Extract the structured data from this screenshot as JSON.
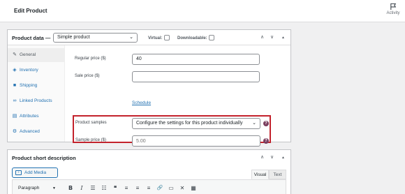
{
  "header": {
    "title": "Edit Product",
    "activity_label": "Activity",
    "activity_icon": "flag-icon"
  },
  "product_data": {
    "title": "Product data —",
    "type_select": {
      "value": "Simple product"
    },
    "virtual_label": "Virtual:",
    "virtual_checked": false,
    "downloadable_label": "Downloadable:",
    "downloadable_checked": false,
    "tabs": [
      {
        "label": "General",
        "icon": "wrench-icon",
        "active": true
      },
      {
        "label": "Inventory",
        "icon": "tag-icon",
        "active": false
      },
      {
        "label": "Shipping",
        "icon": "truck-icon",
        "active": false
      },
      {
        "label": "Linked Products",
        "icon": "link-icon",
        "active": false
      },
      {
        "label": "Attributes",
        "icon": "table-icon",
        "active": false
      },
      {
        "label": "Advanced",
        "icon": "gear-icon",
        "active": false
      }
    ],
    "regular_price": {
      "label": "Regular price ($)",
      "value": "40"
    },
    "sale_price": {
      "label": "Sale price ($)",
      "value": ""
    },
    "schedule_link": "Schedule",
    "product_samples": {
      "label": "Product samples",
      "value": "Configure the settings for this product individually"
    },
    "sample_price": {
      "label": "Sample price ($)",
      "placeholder": "5.00"
    }
  },
  "short_description": {
    "title": "Product short description",
    "add_media_label": "Add Media",
    "editor_tabs": {
      "visual": "Visual",
      "text": "Text"
    },
    "format_select": "Paragraph",
    "toolbar_buttons": [
      {
        "name": "bold-button",
        "glyph": "B"
      },
      {
        "name": "italic-button",
        "glyph": "I"
      },
      {
        "name": "bullet-list-button",
        "glyph": "☰"
      },
      {
        "name": "numbered-list-button",
        "glyph": "☷"
      },
      {
        "name": "blockquote-button",
        "glyph": "❝"
      },
      {
        "name": "align-left-button",
        "glyph": "≡"
      },
      {
        "name": "align-center-button",
        "glyph": "≡"
      },
      {
        "name": "align-right-button",
        "glyph": "≡"
      },
      {
        "name": "insert-link-button",
        "glyph": "🔗"
      },
      {
        "name": "read-more-button",
        "glyph": "▭"
      },
      {
        "name": "fullscreen-button",
        "glyph": "✕"
      },
      {
        "name": "toolbar-toggle-button",
        "glyph": "▦"
      }
    ]
  },
  "colors": {
    "accent": "#2271b1",
    "highlight_border": "#c3222c",
    "help_icon": "#7a3e5e"
  }
}
